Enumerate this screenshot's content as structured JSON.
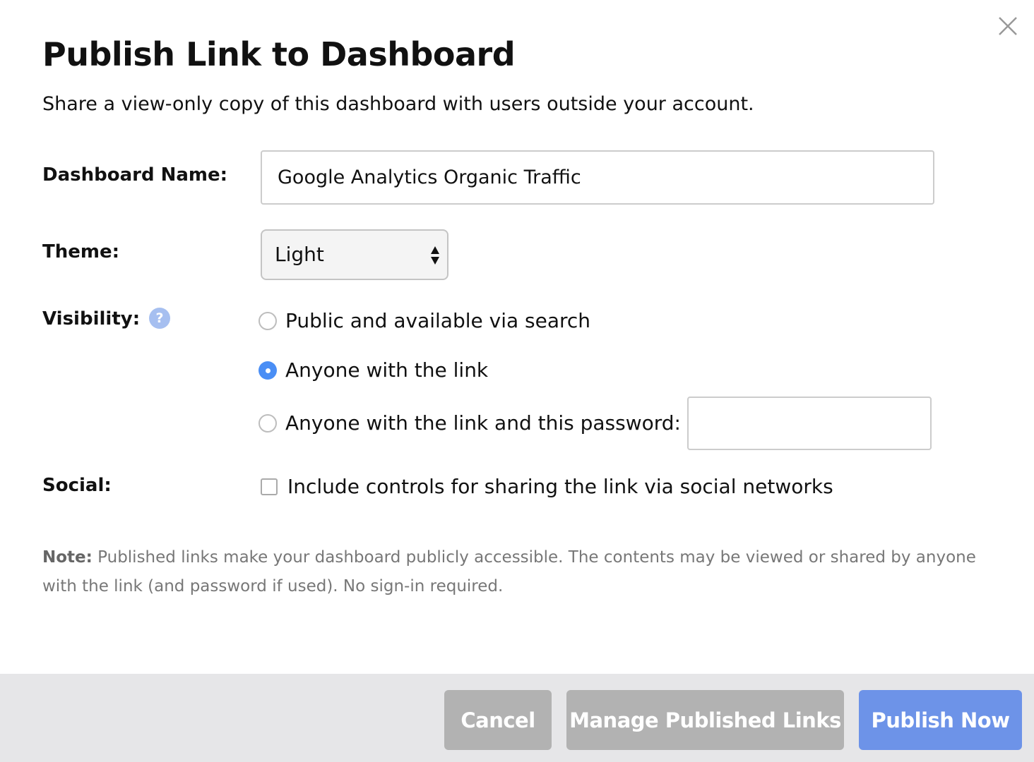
{
  "dialog": {
    "title": "Publish Link to Dashboard",
    "subtitle": "Share a view-only copy of this dashboard with users outside your account.",
    "close_icon": "close-icon"
  },
  "form": {
    "name_label": "Dashboard Name:",
    "name_value": "Google Analytics Organic Traffic",
    "theme_label": "Theme:",
    "theme_value": "Light",
    "visibility_label": "Visibility:",
    "help_glyph": "?",
    "visibility_options": [
      {
        "label": "Public and available via search",
        "selected": false
      },
      {
        "label": "Anyone with the link",
        "selected": true
      },
      {
        "label": "Anyone with the link and this password:",
        "selected": false
      }
    ],
    "password_value": "",
    "social_label": "Social:",
    "social_option": "Include controls for sharing the link via social networks",
    "social_checked": false
  },
  "note": {
    "prefix": "Note:",
    "text": " Published links make your dashboard publicly accessible. The contents may be viewed or shared by anyone with the link (and password if used). No sign-in required."
  },
  "footer": {
    "cancel": "Cancel",
    "manage": "Manage Published Links",
    "publish": "Publish Now"
  },
  "colors": {
    "accent": "#6d93e8",
    "radio_selected": "#4a8ef5",
    "button_gray": "#b2b2b2",
    "footer_bg": "#e6e6e8"
  }
}
